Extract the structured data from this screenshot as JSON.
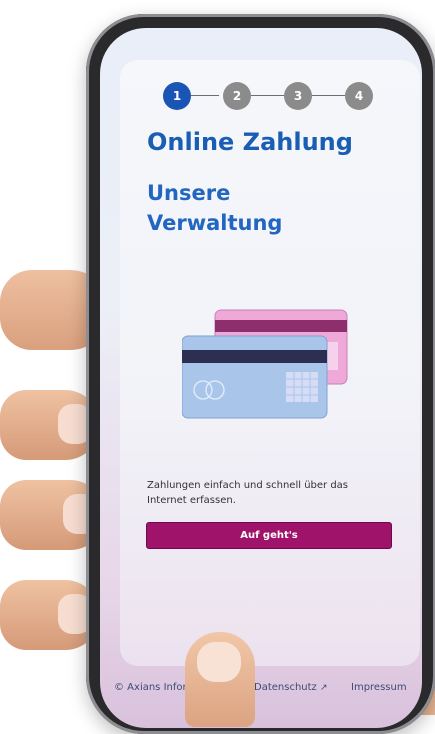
{
  "stepper": {
    "steps": [
      "1",
      "2",
      "3",
      "4"
    ],
    "active_index": 0
  },
  "main": {
    "title": "Online Zahlung",
    "subtitle": "Unsere Verwaltung",
    "description": "Zahlungen einfach und schnell über das Internet erfassen.",
    "cta_label": "Auf geht's"
  },
  "footer": {
    "copyright": "© Axians Infom",
    "privacy": "Datenschutz",
    "imprint": "Impressum"
  },
  "icons": {
    "external_link": "↗"
  },
  "colors": {
    "primary_blue": "#1a5db4",
    "cta_magenta": "#a0136b",
    "step_inactive": "#8b8b8b"
  }
}
